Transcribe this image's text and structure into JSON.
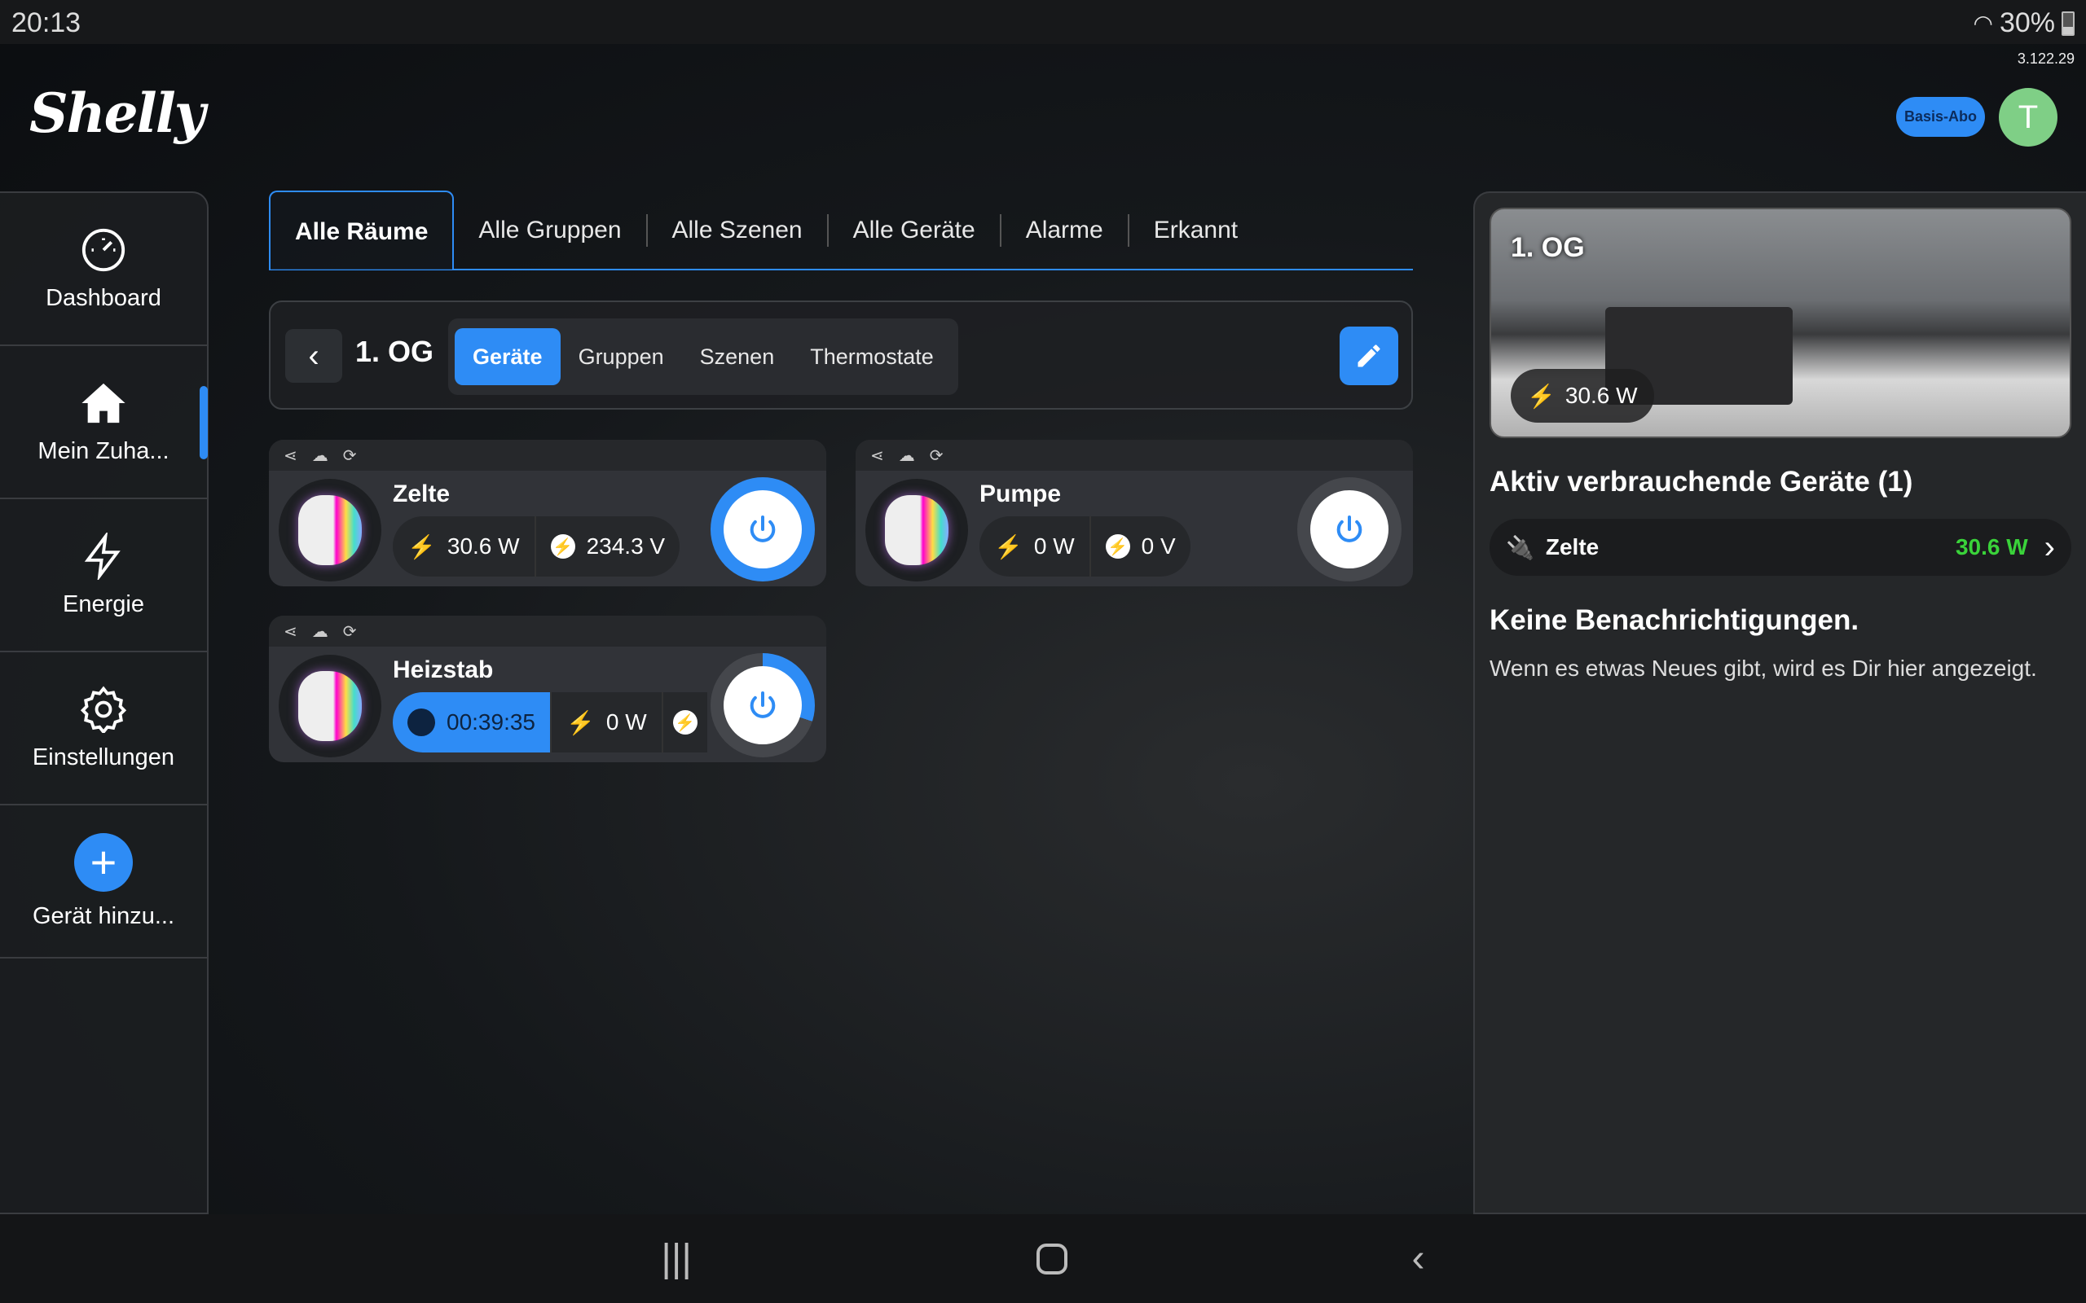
{
  "status": {
    "time": "20:13",
    "battery": "30%",
    "wifi_icon": "wifi-icon"
  },
  "app": {
    "version": "3.122.29",
    "logo": "Shelly",
    "subscription": "Basis-Abo",
    "avatar_initial": "T",
    "accent": "#2e8cf5"
  },
  "sidebar": {
    "items": [
      {
        "label": "Dashboard",
        "icon": "dashboard-icon"
      },
      {
        "label": "Mein Zuha...",
        "icon": "home-icon",
        "active": true
      },
      {
        "label": "Energie",
        "icon": "bolt-icon"
      },
      {
        "label": "Einstellungen",
        "icon": "gear-icon"
      },
      {
        "label": "Gerät hinzu...",
        "icon": "plus-icon"
      }
    ]
  },
  "tabs": [
    {
      "label": "Alle Räume",
      "active": true
    },
    {
      "label": "Alle Gruppen"
    },
    {
      "label": "Alle Szenen"
    },
    {
      "label": "Alle Geräte"
    },
    {
      "label": "Alarme"
    },
    {
      "label": "Erkannt"
    }
  ],
  "room": {
    "name": "1. OG",
    "subtabs": [
      {
        "label": "Geräte",
        "active": true
      },
      {
        "label": "Gruppen"
      },
      {
        "label": "Szenen"
      },
      {
        "label": "Thermostate"
      }
    ]
  },
  "devices": [
    {
      "name": "Zelte",
      "power": "30.6 W",
      "voltage": "234.3 V",
      "on": true
    },
    {
      "name": "Pumpe",
      "power": "0 W",
      "voltage": "0 V",
      "on": false
    },
    {
      "name": "Heizstab",
      "timer": "00:39:35",
      "power": "0 W",
      "on": false,
      "timer_progress": 0.3
    }
  ],
  "panel": {
    "room_title": "1. OG",
    "room_power": "30.6 W",
    "active_heading": "Aktiv verbrauchende Geräte (1)",
    "active_devices": [
      {
        "name": "Zelte",
        "power": "30.6 W"
      }
    ],
    "notif_heading": "Keine Benachrichtigungen.",
    "notif_text": "Wenn es etwas Neues gibt, wird es Dir hier angezeigt."
  }
}
